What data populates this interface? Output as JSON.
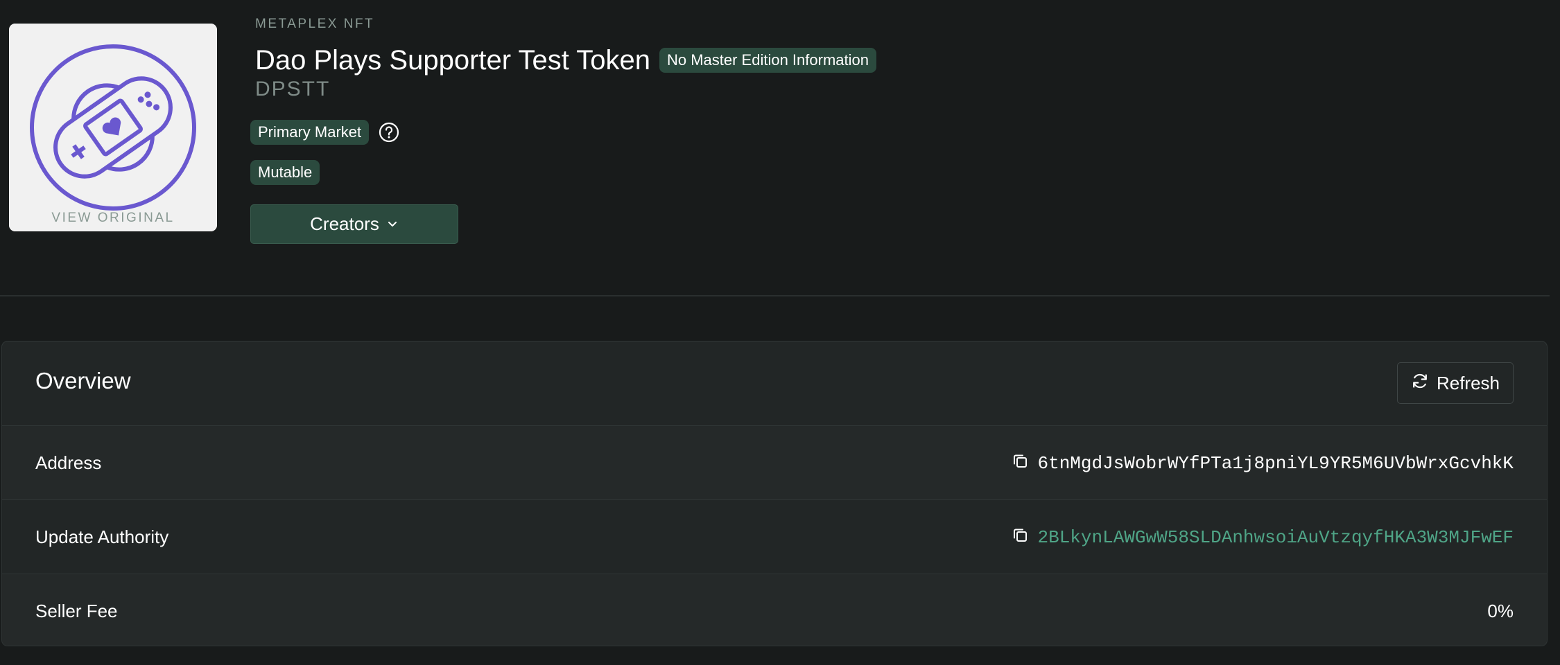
{
  "header": {
    "pretitle": "METAPLEX NFT",
    "title": "Dao Plays Supporter Test Token",
    "edition_badge": "No Master Edition Information",
    "symbol": "DPSTT",
    "market_badge": "Primary Market",
    "mutability_badge": "Mutable",
    "creators_label": "Creators",
    "view_original_label": "VIEW ORIGINAL",
    "image_icon": "gamepad-bandage-icon"
  },
  "overview": {
    "title": "Overview",
    "refresh_label": "Refresh",
    "rows": [
      {
        "label": "Address",
        "value": "6tnMgdJsWobrWYfPTa1j8pniYL9YR5M6UVbWrxGcvhkK"
      },
      {
        "label": "Update Authority",
        "value": "2BLkynLAWGwW58SLDAnhwsoiAuVtzqyfHKA3W3MJFwEF"
      },
      {
        "label": "Seller Fee",
        "value": "0%"
      }
    ]
  },
  "colors": {
    "background": "#181b1b",
    "badge": "#2b4a3e",
    "accent_link": "#4fa587",
    "image_purple": "#6a58cf",
    "muted_text": "#8a9a94"
  }
}
